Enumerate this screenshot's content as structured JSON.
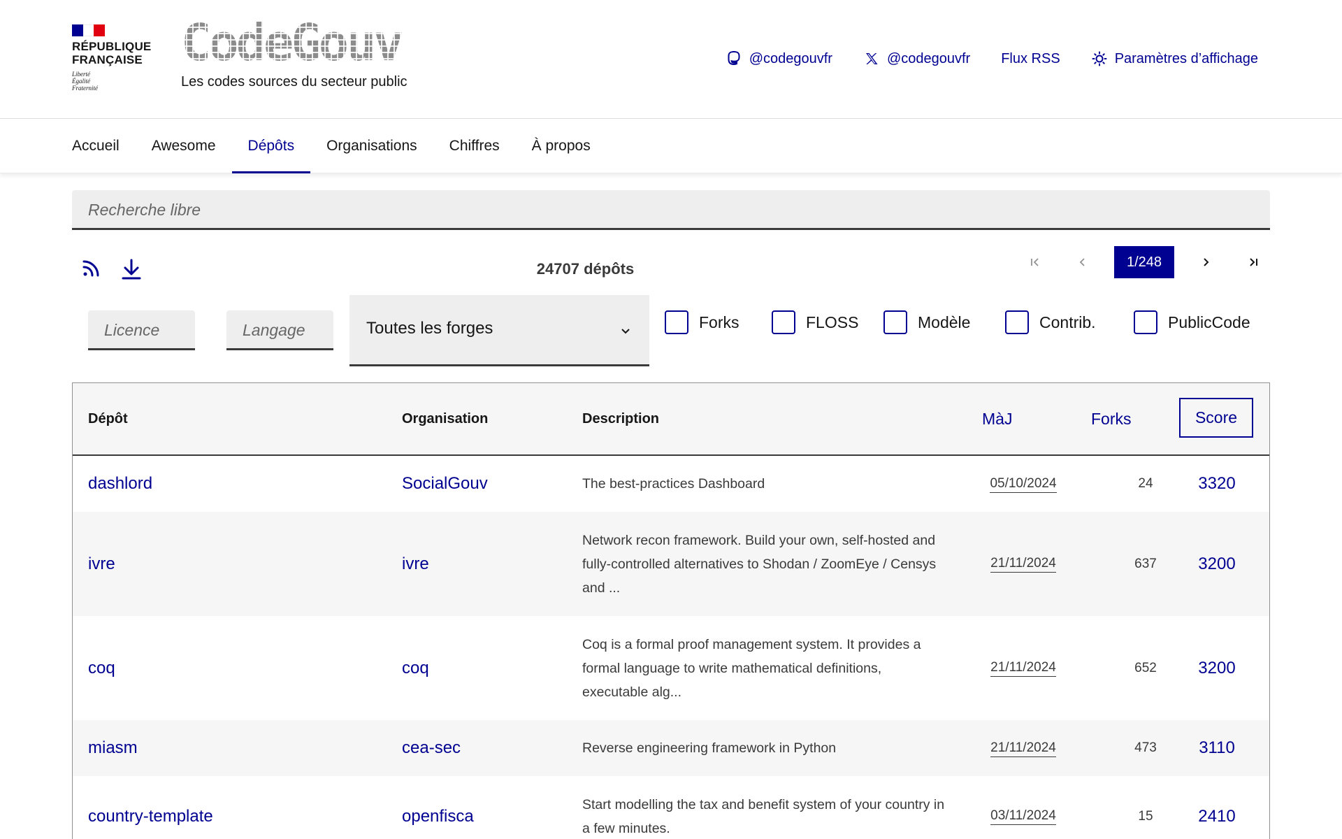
{
  "header": {
    "republique_line1": "RÉPUBLIQUE",
    "republique_line2": "FRANÇAISE",
    "motto1": "Liberté",
    "motto2": "Égalité",
    "motto3": "Fraternité",
    "logo": "CodeGouv",
    "tagline": "Les codes sources du secteur public",
    "tools": {
      "mastodon": "@codegouvfr",
      "x": "@codegouvfr",
      "rss": "Flux RSS",
      "display": "Paramètres d’affichage"
    }
  },
  "nav": {
    "items": [
      "Accueil",
      "Awesome",
      "Dépôts",
      "Organisations",
      "Chiffres",
      "À propos"
    ],
    "active": "Dépôts"
  },
  "search": {
    "placeholder": "Recherche libre"
  },
  "toolbar": {
    "count": "24707 dépôts",
    "pagination": {
      "first": "⇤",
      "prev": "‹",
      "current": "1/248",
      "next": "›",
      "last": "⇥"
    }
  },
  "filters": {
    "licence_placeholder": "Licence",
    "langage_placeholder": "Langage",
    "forge_selected": "Toutes les forges",
    "checkboxes": [
      "Forks",
      "FLOSS",
      "Modèle",
      "Contrib.",
      "PublicCode"
    ]
  },
  "table": {
    "headers": {
      "repo": "Dépôt",
      "org": "Organisation",
      "desc": "Description",
      "date": "MàJ",
      "forks": "Forks",
      "score": "Score"
    },
    "rows": [
      {
        "repo": "dashlord",
        "org": "SocialGouv",
        "desc": "The best-practices Dashboard",
        "date": "05/10/2024",
        "forks": "24",
        "score": "3320"
      },
      {
        "repo": "ivre",
        "org": "ivre",
        "desc": "Network recon framework. Build your own, self-hosted and fully-controlled alternatives to Shodan / ZoomEye / Censys and ...",
        "date": "21/11/2024",
        "forks": "637",
        "score": "3200"
      },
      {
        "repo": "coq",
        "org": "coq",
        "desc": "Coq is a formal proof management system. It provides a formal language to write mathematical definitions, executable alg...",
        "date": "21/11/2024",
        "forks": "652",
        "score": "3200"
      },
      {
        "repo": "miasm",
        "org": "cea-sec",
        "desc": "Reverse engineering framework in Python",
        "date": "21/11/2024",
        "forks": "473",
        "score": "3110"
      },
      {
        "repo": "country-template",
        "org": "openfisca",
        "desc": "Start modelling the tax and benefit system of your country in a few minutes.",
        "date": "03/11/2024",
        "forks": "15",
        "score": "2410"
      }
    ]
  },
  "colors": {
    "accent": "#000091",
    "flag_red": "#e1000f",
    "grey_bg": "#eeeeee",
    "row_alt": "#f6f6f6"
  }
}
